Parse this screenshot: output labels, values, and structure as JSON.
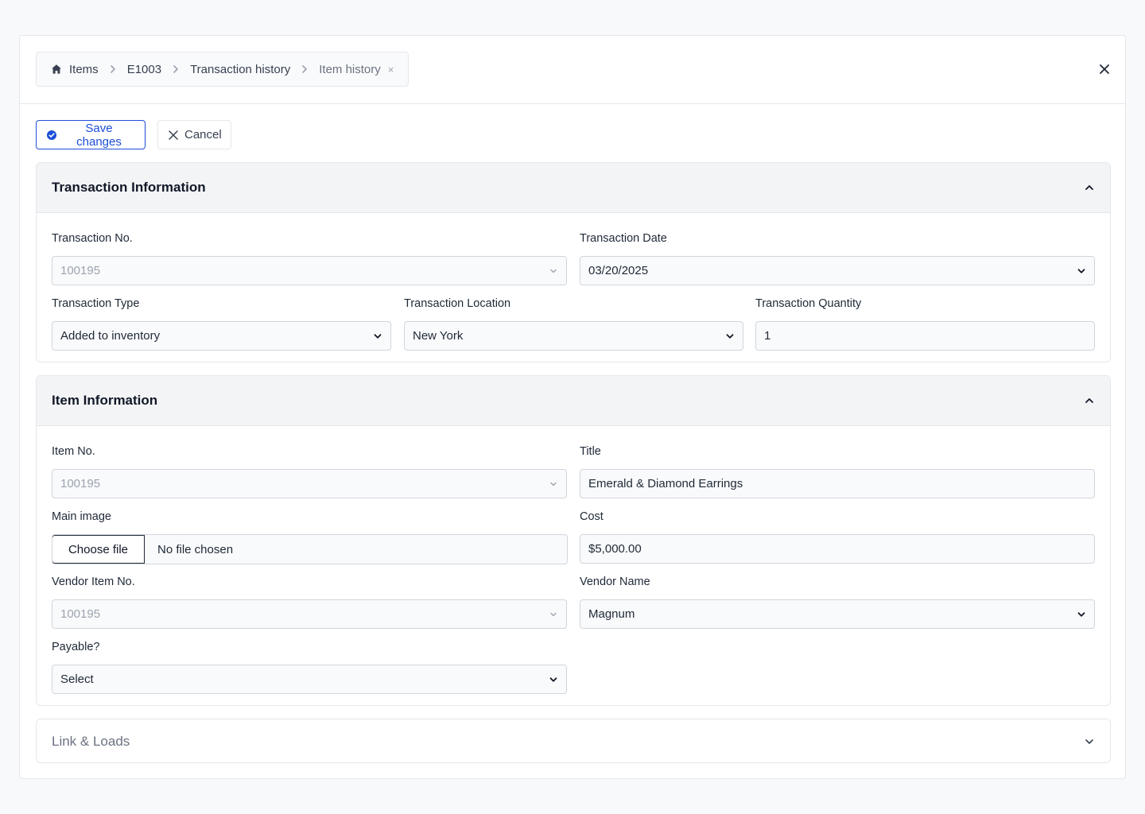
{
  "breadcrumb": {
    "items": [
      {
        "label": "Items"
      },
      {
        "label": "E1003"
      },
      {
        "label": "Transaction history"
      },
      {
        "label": "Item history"
      }
    ],
    "close_glyph": "×"
  },
  "toolbar": {
    "save_label": "Save changes",
    "cancel_label": "Cancel"
  },
  "transaction_section": {
    "title": "Transaction Information",
    "fields": {
      "transaction_no": {
        "label": "Transaction No.",
        "value": "100195"
      },
      "transaction_date": {
        "label": "Transaction Date",
        "value": "03/20/2025"
      },
      "transaction_type": {
        "label": "Transaction Type",
        "value": "Added to inventory"
      },
      "transaction_location": {
        "label": "Transaction Location",
        "value": "New York"
      },
      "transaction_quantity": {
        "label": "Transaction Quantity",
        "value": "1"
      }
    }
  },
  "item_section": {
    "title": "Item Information",
    "fields": {
      "item_no": {
        "label": "Item No.",
        "value": "100195"
      },
      "title": {
        "label": "Title",
        "value": "Emerald & Diamond Earrings"
      },
      "main_image": {
        "label": "Main image",
        "button": "Choose file",
        "status": "No file chosen"
      },
      "cost": {
        "label": "Cost",
        "value": "$5,000.00"
      },
      "vendor_item_no": {
        "label": "Vendor Item No.",
        "value": "100195"
      },
      "vendor_name": {
        "label": "Vendor Name",
        "value": "Magnum"
      },
      "payable": {
        "label": "Payable?",
        "value": "Select"
      }
    }
  },
  "links_section": {
    "title": "Link & Loads"
  },
  "colors": {
    "primary": "#1d4ed8",
    "border": "#e5e7eb",
    "header_bg": "#f3f4f6"
  }
}
